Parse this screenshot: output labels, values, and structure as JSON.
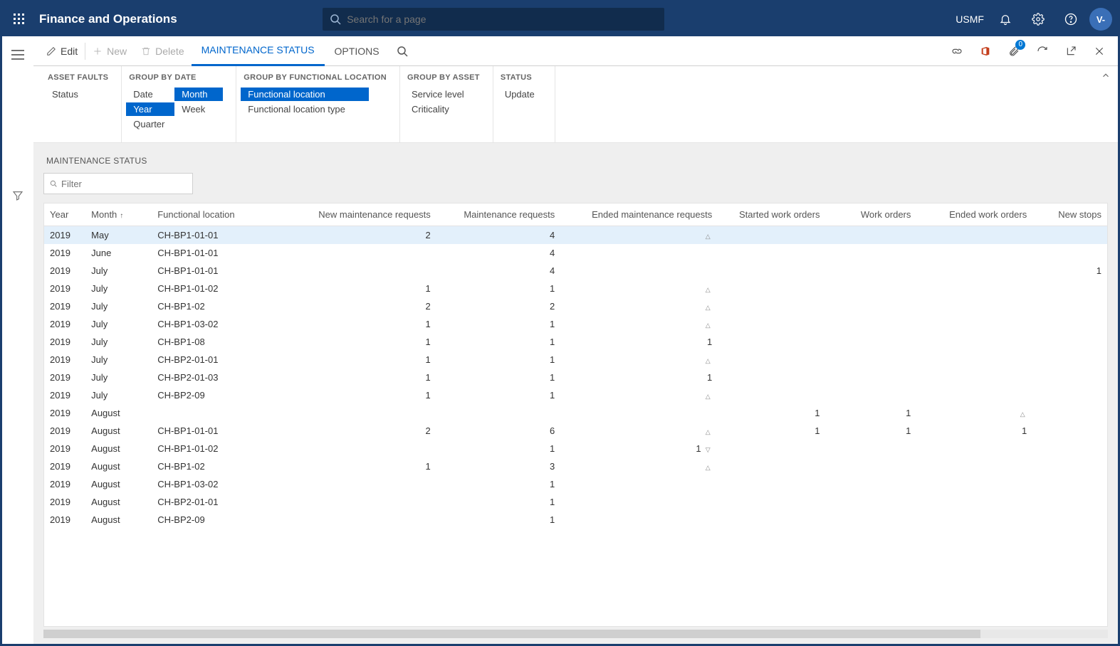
{
  "header": {
    "app_title": "Finance and Operations",
    "search_placeholder": "Search for a page",
    "company": "USMF",
    "avatar_initials": "V-"
  },
  "actionbar": {
    "edit": "Edit",
    "new": "New",
    "delete": "Delete",
    "tab_active": "MAINTENANCE STATUS",
    "tab_options": "OPTIONS",
    "attach_badge": "0"
  },
  "ribbon": {
    "asset_faults": {
      "title": "ASSET FAULTS",
      "items": [
        "Status"
      ]
    },
    "group_by_date": {
      "title": "GROUP BY DATE",
      "row1": [
        {
          "label": "Date",
          "sel": false
        },
        {
          "label": "Month",
          "sel": true
        }
      ],
      "row2": [
        {
          "label": "Year",
          "sel": true
        },
        {
          "label": "Week",
          "sel": false
        }
      ],
      "row3": [
        {
          "label": "Quarter",
          "sel": false
        }
      ]
    },
    "group_by_loc": {
      "title": "GROUP BY FUNCTIONAL LOCATION",
      "items": [
        {
          "label": "Functional location",
          "sel": true
        },
        {
          "label": "Functional location type",
          "sel": false
        }
      ]
    },
    "group_by_asset": {
      "title": "GROUP BY ASSET",
      "items": [
        "Service level",
        "Criticality"
      ]
    },
    "status": {
      "title": "STATUS",
      "items": [
        "Update"
      ]
    }
  },
  "grid": {
    "section_title": "MAINTENANCE STATUS",
    "filter_placeholder": "Filter",
    "columns": [
      "Year",
      "Month",
      "Functional location",
      "New maintenance requests",
      "Maintenance requests",
      "Ended maintenance requests",
      "Started work orders",
      "Work orders",
      "Ended work orders",
      "New stops"
    ],
    "sort_col": 1,
    "sort_dir": "asc",
    "rows": [
      {
        "year": "2019",
        "month": "May",
        "loc": "CH-BP1-01-01",
        "new_mr": "2",
        "mr": "4",
        "ended_mr_tri": "up",
        "ended_mr": "",
        "swo": "",
        "wo": "",
        "ewo": "",
        "ewo_tri": "",
        "ns": "",
        "selected": true
      },
      {
        "year": "2019",
        "month": "June",
        "loc": "CH-BP1-01-01",
        "new_mr": "",
        "mr": "4",
        "ended_mr_tri": "",
        "ended_mr": "",
        "swo": "",
        "wo": "",
        "ewo": "",
        "ewo_tri": "",
        "ns": ""
      },
      {
        "year": "2019",
        "month": "July",
        "loc": "CH-BP1-01-01",
        "new_mr": "",
        "mr": "4",
        "ended_mr_tri": "",
        "ended_mr": "",
        "swo": "",
        "wo": "",
        "ewo": "",
        "ewo_tri": "",
        "ns": "1"
      },
      {
        "year": "2019",
        "month": "July",
        "loc": "CH-BP1-01-02",
        "new_mr": "1",
        "mr": "1",
        "ended_mr_tri": "up",
        "ended_mr": "",
        "swo": "",
        "wo": "",
        "ewo": "",
        "ewo_tri": "",
        "ns": ""
      },
      {
        "year": "2019",
        "month": "July",
        "loc": "CH-BP1-02",
        "new_mr": "2",
        "mr": "2",
        "ended_mr_tri": "up",
        "ended_mr": "",
        "swo": "",
        "wo": "",
        "ewo": "",
        "ewo_tri": "",
        "ns": ""
      },
      {
        "year": "2019",
        "month": "July",
        "loc": "CH-BP1-03-02",
        "new_mr": "1",
        "mr": "1",
        "ended_mr_tri": "up",
        "ended_mr": "",
        "swo": "",
        "wo": "",
        "ewo": "",
        "ewo_tri": "",
        "ns": ""
      },
      {
        "year": "2019",
        "month": "July",
        "loc": "CH-BP1-08",
        "new_mr": "1",
        "mr": "1",
        "ended_mr_tri": "",
        "ended_mr": "1",
        "swo": "",
        "wo": "",
        "ewo": "",
        "ewo_tri": "",
        "ns": ""
      },
      {
        "year": "2019",
        "month": "July",
        "loc": "CH-BP2-01-01",
        "new_mr": "1",
        "mr": "1",
        "ended_mr_tri": "up",
        "ended_mr": "",
        "swo": "",
        "wo": "",
        "ewo": "",
        "ewo_tri": "",
        "ns": ""
      },
      {
        "year": "2019",
        "month": "July",
        "loc": "CH-BP2-01-03",
        "new_mr": "1",
        "mr": "1",
        "ended_mr_tri": "",
        "ended_mr": "1",
        "swo": "",
        "wo": "",
        "ewo": "",
        "ewo_tri": "",
        "ns": ""
      },
      {
        "year": "2019",
        "month": "July",
        "loc": "CH-BP2-09",
        "new_mr": "1",
        "mr": "1",
        "ended_mr_tri": "up",
        "ended_mr": "",
        "swo": "",
        "wo": "",
        "ewo": "",
        "ewo_tri": "",
        "ns": ""
      },
      {
        "year": "2019",
        "month": "August",
        "loc": "",
        "new_mr": "",
        "mr": "",
        "ended_mr_tri": "",
        "ended_mr": "",
        "swo": "1",
        "wo": "1",
        "ewo": "",
        "ewo_tri": "up",
        "ns": ""
      },
      {
        "year": "2019",
        "month": "August",
        "loc": "CH-BP1-01-01",
        "new_mr": "2",
        "mr": "6",
        "ended_mr_tri": "up",
        "ended_mr": "",
        "swo": "1",
        "wo": "1",
        "ewo": "1",
        "ewo_tri": "",
        "ns": ""
      },
      {
        "year": "2019",
        "month": "August",
        "loc": "CH-BP1-01-02",
        "new_mr": "",
        "mr": "1",
        "ended_mr_tri": "down",
        "ended_mr": "1",
        "swo": "",
        "wo": "",
        "ewo": "",
        "ewo_tri": "",
        "ns": ""
      },
      {
        "year": "2019",
        "month": "August",
        "loc": "CH-BP1-02",
        "new_mr": "1",
        "mr": "3",
        "ended_mr_tri": "up",
        "ended_mr": "",
        "swo": "",
        "wo": "",
        "ewo": "",
        "ewo_tri": "",
        "ns": ""
      },
      {
        "year": "2019",
        "month": "August",
        "loc": "CH-BP1-03-02",
        "new_mr": "",
        "mr": "1",
        "ended_mr_tri": "",
        "ended_mr": "",
        "swo": "",
        "wo": "",
        "ewo": "",
        "ewo_tri": "",
        "ns": ""
      },
      {
        "year": "2019",
        "month": "August",
        "loc": "CH-BP2-01-01",
        "new_mr": "",
        "mr": "1",
        "ended_mr_tri": "",
        "ended_mr": "",
        "swo": "",
        "wo": "",
        "ewo": "",
        "ewo_tri": "",
        "ns": ""
      },
      {
        "year": "2019",
        "month": "August",
        "loc": "CH-BP2-09",
        "new_mr": "",
        "mr": "1",
        "ended_mr_tri": "",
        "ended_mr": "",
        "swo": "",
        "wo": "",
        "ewo": "",
        "ewo_tri": "",
        "ns": ""
      }
    ]
  }
}
